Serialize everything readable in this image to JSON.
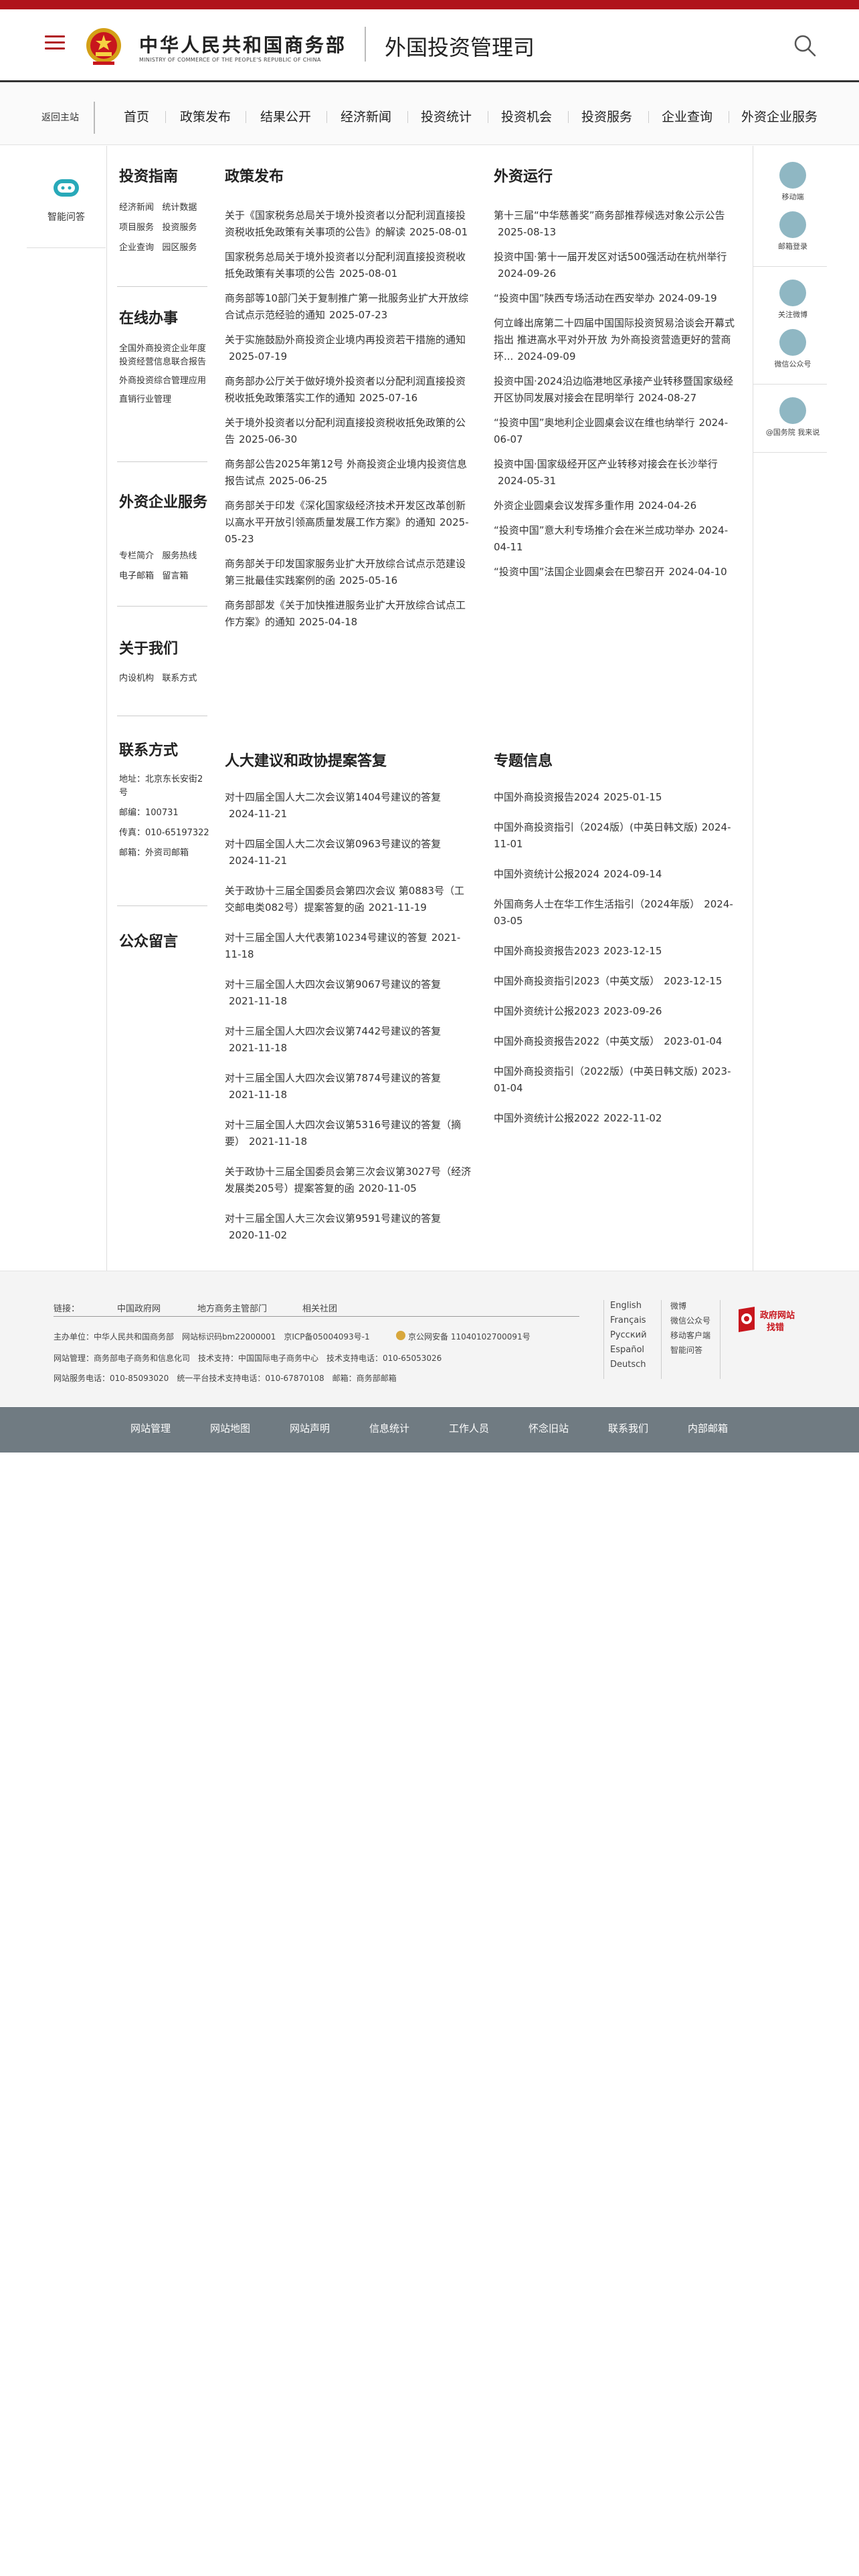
{
  "header": {
    "logo_cn": "中华人民共和国商务部",
    "logo_en": "MINISTRY OF COMMERCE OF THE PEOPLE'S REPUBLIC OF CHINA",
    "site_name": "外国投资管理司",
    "brand_color": "#b0131c"
  },
  "nav": {
    "home": "返回主站",
    "items": [
      "首页",
      "政策发布",
      "结果公开",
      "经济新闻",
      "投资统计",
      "投资机会",
      "投资服务",
      "企业查询",
      "外资企业服务"
    ]
  },
  "left": {
    "assistant_label": "智能问答"
  },
  "sidebar": {
    "guide_title": "投资指南",
    "guide_links": [
      [
        "经济新闻",
        "统计数据"
      ],
      [
        "项目服务",
        "投资服务"
      ],
      [
        "企业查询",
        "园区服务"
      ]
    ],
    "online_title": "在线办事",
    "online_links": [
      "全国外商投资企业年度投资经营信息联合报告",
      "外商投资综合管理应用",
      "直销行业管理"
    ],
    "foreign_title": "外资企业服务",
    "foreign_links": [
      [
        "专栏简介",
        "服务热线"
      ],
      [
        "电子邮箱",
        "留言箱"
      ]
    ],
    "about_title": "关于我们",
    "about_links": [
      [
        "内设机构",
        "联系方式"
      ]
    ],
    "contact_title": "联系方式",
    "contact_address": "地址：北京东长安街2号",
    "contact_postcode": "邮编：100731",
    "contact_fax": "传真：010-65197322",
    "contact_mail": "邮箱：外资司邮箱",
    "message_title": "公众留言"
  },
  "policy": {
    "title": "政策发布",
    "items": [
      {
        "text": "关于《国家税务总局关于境外投资者以分配利润直接投资税收抵免政策有关事项的公告》的解读",
        "date": "2025-08-01"
      },
      {
        "text": "国家税务总局关于境外投资者以分配利润直接投资税收抵免政策有关事项的公告",
        "date": "2025-08-01"
      },
      {
        "text": "商务部等10部门关于复制推广第一批服务业扩大开放综合试点示范经验的通知",
        "date": "2025-07-23"
      },
      {
        "text": "关于实施鼓励外商投资企业境内再投资若干措施的通知",
        "date": "2025-07-19"
      },
      {
        "text": "商务部办公厅关于做好境外投资者以分配利润直接投资税收抵免政策落实工作的通知",
        "date": "2025-07-16"
      },
      {
        "text": "关于境外投资者以分配利润直接投资税收抵免政策的公告",
        "date": "2025-06-30"
      },
      {
        "text": "商务部公告2025年第12号 外商投资企业境内投资信息报告试点",
        "date": "2025-06-25"
      },
      {
        "text": "商务部关于印发《深化国家级经济技术开发区改革创新以高水平开放引领高质量发展工作方案》的通知",
        "date": "2025-05-23"
      },
      {
        "text": "商务部关于印发国家服务业扩大开放综合试点示范建设第三批最佳实践案例的函",
        "date": "2025-05-16"
      },
      {
        "text": "商务部部发《关于加快推进服务业扩大开放综合试点工作方案》的通知",
        "date": "2025-04-18"
      }
    ]
  },
  "operations": {
    "title": "外资运行",
    "items": [
      {
        "text": "第十三届“中华慈善奖”商务部推荐候选对象公示公告",
        "date": "2025-08-13"
      },
      {
        "text": "投资中国·第十一届开发区对话500强活动在杭州举行",
        "date": "2024-09-26"
      },
      {
        "text": "“投资中国”陕西专场活动在西安举办",
        "date": "2024-09-19"
      },
      {
        "text": "何立峰出席第二十四届中国国际投资贸易洽谈会开幕式指出 推进高水平对外开放 为外商投资营造更好的营商环...",
        "date": "2024-09-09"
      },
      {
        "text": "投资中国·2024沿边临港地区承接产业转移暨国家级经开区协同发展对接会在昆明举行",
        "date": "2024-08-27"
      },
      {
        "text": "“投资中国”奥地利企业圆桌会议在维也纳举行",
        "date": "2024-06-07"
      },
      {
        "text": "投资中国·国家级经开区产业转移对接会在长沙举行",
        "date": "2024-05-31"
      },
      {
        "text": "外资企业圆桌会议发挥多重作用",
        "date": "2024-04-26"
      },
      {
        "text": "“投资中国”意大利专场推介会在米兰成功举办",
        "date": "2024-04-11"
      },
      {
        "text": "“投资中国”法国企业圆桌会在巴黎召开",
        "date": "2024-04-10"
      }
    ]
  },
  "npc": {
    "title": "人大建议和政协提案答复",
    "items": [
      {
        "text": "对十四届全国人大二次会议第1404号建议的答复",
        "date": "2024-11-21"
      },
      {
        "text": "对十四届全国人大二次会议第0963号建议的答复",
        "date": "2024-11-21"
      },
      {
        "text": "关于政协十三届全国委员会第四次会议 第0883号（工交邮电类082号）提案答复的函",
        "date": "2021-11-19"
      },
      {
        "text": "对十三届全国人大代表第10234号建议的答复",
        "date": "2021-11-18"
      },
      {
        "text": "对十三届全国人大四次会议第9067号建议的答复",
        "date": "2021-11-18"
      },
      {
        "text": "对十三届全国人大四次会议第7442号建议的答复",
        "date": "2021-11-18"
      },
      {
        "text": "对十三届全国人大四次会议第7874号建议的答复",
        "date": "2021-11-18"
      },
      {
        "text": "对十三届全国人大四次会议第5316号建议的答复（摘要）",
        "date": "2021-11-18"
      },
      {
        "text": "关于政协十三届全国委员会第三次会议第3027号（经济发展类205号）提案答复的函",
        "date": "2020-11-05"
      },
      {
        "text": "对十三届全国人大三次会议第9591号建议的答复",
        "date": "2020-11-02"
      }
    ]
  },
  "special": {
    "title": "专题信息",
    "items": [
      {
        "text": "中国外商投资报告2024",
        "date": "2025-01-15"
      },
      {
        "text": "中国外商投资指引（2024版）(中英日韩文版)",
        "date": "2024-11-01"
      },
      {
        "text": "中国外资统计公报2024",
        "date": "2024-09-14"
      },
      {
        "text": "外国商务人士在华工作生活指引（2024年版）",
        "date": "2024-03-05"
      },
      {
        "text": "中国外商投资报告2023",
        "date": "2023-12-15"
      },
      {
        "text": "中国外商投资指引2023（中英文版）",
        "date": "2023-12-15"
      },
      {
        "text": "中国外资统计公报2023",
        "date": "2023-09-26"
      },
      {
        "text": "中国外商投资报告2022（中英文版）",
        "date": "2023-01-04"
      },
      {
        "text": "中国外商投资指引（2022版）(中英日韩文版)",
        "date": "2023-01-04"
      },
      {
        "text": "中国外资统计公报2022",
        "date": "2022-11-02"
      }
    ]
  },
  "right": {
    "items": [
      "移动端",
      "邮箱登录",
      "关注微博",
      "微信公众号",
      "@国务院 我来说"
    ]
  },
  "footer": {
    "links_label": "链接：",
    "links": [
      "中国政府网",
      "地方商务主管部门",
      "相关社团"
    ],
    "line1": "主办单位：中华人民共和国商务部　网站标识码bm22000001　京ICP备05004093号-1",
    "police": "京公网安备 11040102700091号",
    "line2": "网站管理：商务部电子商务和信息化司　技术支持：中国国际电子商务中心　技术支持电话：010-65053026",
    "line3": "网站服务电话：010-85093020　统一平台技术支持电话：010-67870108　邮箱：商务部邮箱",
    "languages": [
      "English",
      "Français",
      "Русский",
      "Español",
      "Deutsch"
    ],
    "social": [
      "微博",
      "微信公众号",
      "移动客户端",
      "智能问答"
    ],
    "gov_badge_a": "政府网站",
    "gov_badge_b": "找错"
  },
  "bottom_bar": {
    "items": [
      "网站管理",
      "网站地图",
      "网站声明",
      "信息统计",
      "工作人员",
      "怀念旧站",
      "联系我们",
      "内部邮箱"
    ]
  }
}
